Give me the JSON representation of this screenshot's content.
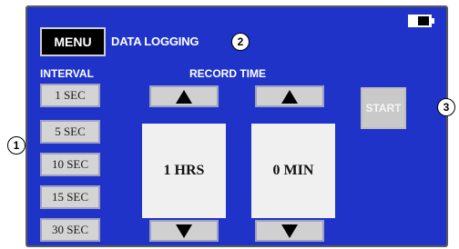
{
  "header": {
    "menu_label": "MENU",
    "title": "DATA LOGGING"
  },
  "interval": {
    "heading": "INTERVAL",
    "options": [
      "1 SEC",
      "5 SEC",
      "10 SEC",
      "15 SEC",
      "30 SEC"
    ]
  },
  "record_time": {
    "heading": "RECORD TIME",
    "hours_value": "1 HRS",
    "minutes_value": "0 MIN"
  },
  "start_label": "START",
  "callouts": [
    "1",
    "2",
    "3"
  ],
  "colors": {
    "screen_bg": "#1f33c9",
    "button_bg": "#d4d4d4",
    "start_disabled": "#c9c9c9"
  },
  "icons": [
    "up-arrow-icon",
    "down-arrow-icon",
    "battery-icon"
  ]
}
